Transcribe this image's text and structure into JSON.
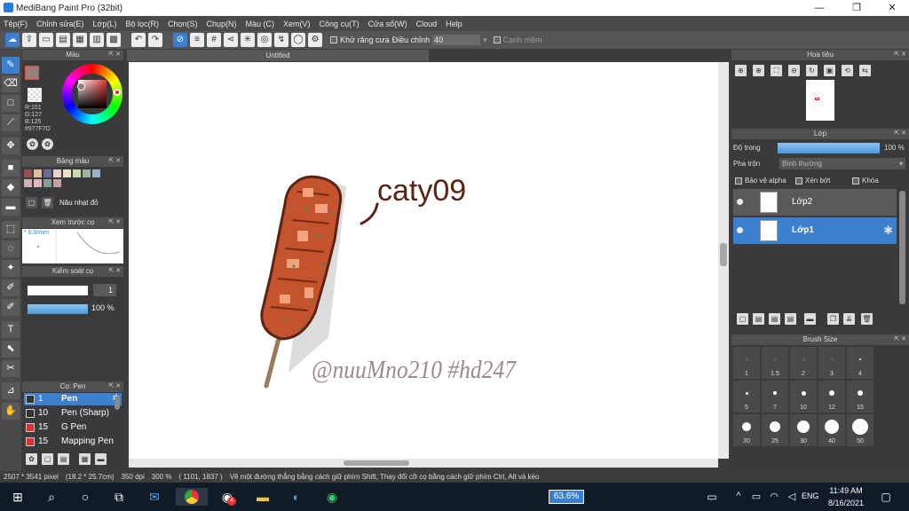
{
  "app": {
    "title": "MediBang Paint Pro (32bit)"
  },
  "menu": [
    "Tệp(F)",
    "Chỉnh sửa(E)",
    "Lớp(L)",
    "Bộ lọc(R)",
    "Chọn(S)",
    "Chụp(N)",
    "Màu (C)",
    "Xem(V)",
    "Công cụ(T)",
    "Cửa sổ(W)",
    "Cloud",
    "Help"
  ],
  "toolbar": {
    "antialias_label": "Khử răng cưa",
    "adjust_label": "Điều chỉnh",
    "adjust_value": "40",
    "edge_label": "Cạnh mềm"
  },
  "color_panel": {
    "title": "Màu",
    "r": "R:151",
    "g": "G:127",
    "b": "B:125",
    "hex": "#977F7D"
  },
  "palette_panel": {
    "title": "Bảng màu",
    "swatch_name": "Nâu nhạt đỏ",
    "swatches": [
      "#9b4d4d",
      "#d9c0a0",
      "#6a6a9a",
      "#e8d0d0",
      "#f0e0c8",
      "#c8d8b0",
      "#a0b0a0",
      "#9ab0c8",
      "#d0b0b0",
      "#e0b8c0",
      "#80a0a0",
      "#c0a0a0"
    ]
  },
  "preview_panel": {
    "title": "Xem trước cọ",
    "value": "* 0.0/mm"
  },
  "control_panel": {
    "title": "Kiểm soát cọ",
    "size_value": "1",
    "opacity_value": "100 %"
  },
  "brush_panel": {
    "title": "Cọ: Pen",
    "items": [
      {
        "size": "1",
        "name": "Pen",
        "color": "#333333"
      },
      {
        "size": "10",
        "name": "Pen (Sharp)",
        "color": "#333333"
      },
      {
        "size": "15",
        "name": "G Pen",
        "color": "#e03030"
      },
      {
        "size": "15",
        "name": "Mapping Pen",
        "color": "#e03030"
      }
    ]
  },
  "document": {
    "tab": "Untitled",
    "signature": "caty09",
    "handwriting": "@nuuMno210 #hd247"
  },
  "navigator_panel": {
    "title": "Hoa tiêu"
  },
  "layer_panel": {
    "title": "Lớp",
    "opacity_label": "Độ trong",
    "opacity_value": "100 %",
    "blend_label": "Pha trộn",
    "blend_value": "Bình thường",
    "alpha_label": "Bảo vệ alpha",
    "clip_label": "Xén bớt",
    "lock_label": "Khóa",
    "layers": [
      {
        "name": "Lớp2"
      },
      {
        "name": "Lớp1"
      }
    ]
  },
  "brushsize_panel": {
    "title": "Brush Size",
    "sizes": [
      "1",
      "1.5",
      "2",
      "3",
      "4",
      "5",
      "7",
      "10",
      "12",
      "15",
      "20",
      "25",
      "30",
      "40",
      "50"
    ]
  },
  "status": {
    "dims": "2507 * 3541 pixel",
    "cm": "(18.2 * 25.7cm)",
    "dpi": "350 dpi",
    "zoom": "300 %",
    "coords": "( 1101, 1837 )",
    "hint": "Vẽ một đường thẳng bằng cách giữ phím Shift, Thay đổi cỡ cọ bằng cách giữ phím Ctrl, Alt và kéo"
  },
  "taskbar": {
    "zoom_badge": "63.6%",
    "lang": "ENG",
    "time": "11:49 AM",
    "date": "8/16/2021",
    "notif_count": "4"
  }
}
